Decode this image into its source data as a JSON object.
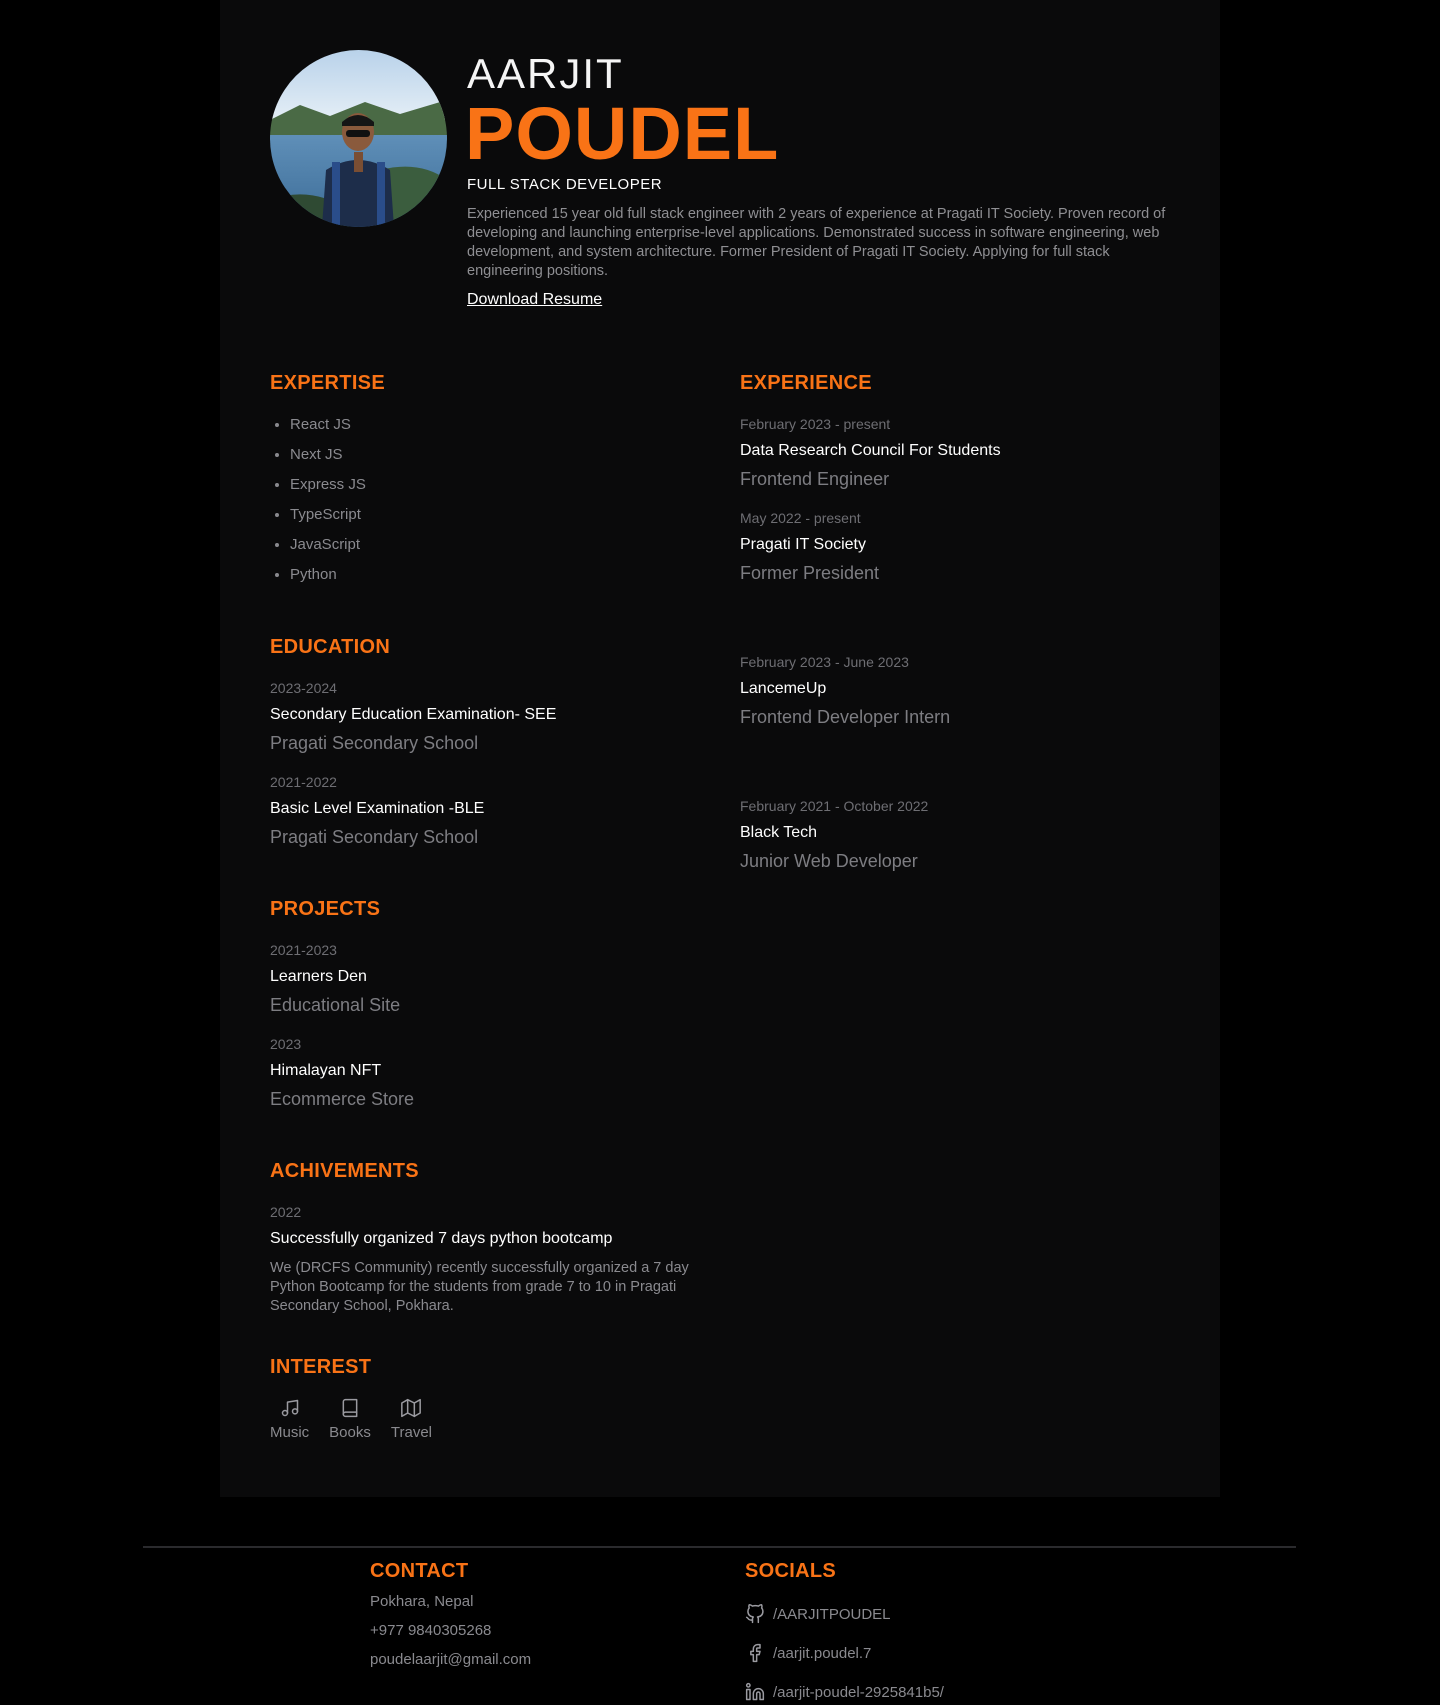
{
  "header": {
    "first_name": "AARJIT",
    "last_name": "POUDEL",
    "role": "FULL STACK DEVELOPER",
    "summary": "Experienced 15 year old full stack engineer with 2 years of experience at Pragati IT Society. Proven record of developing and launching enterprise-level applications. Demonstrated success in software engineering, web development, and system architecture. Former President of Pragati IT Society. Applying for full stack engineering positions.",
    "download_label": "Download Resume",
    "avatar": "profile-photo"
  },
  "expertise": {
    "title": "EXPERTISE",
    "items": [
      "React JS",
      "Next JS",
      "Express JS",
      "TypeScript",
      "JavaScript",
      "Python"
    ]
  },
  "experience": {
    "title": "EXPERIENCE",
    "items": [
      {
        "date": "February 2023 - present",
        "title": "Data Research Council For Students",
        "role": "Frontend Engineer"
      },
      {
        "date": "May 2022 - present",
        "title": "Pragati IT Society",
        "role": "Former President"
      },
      {
        "date": "February 2023 - June 2023",
        "title": "LancemeUp",
        "role": "Frontend Developer Intern"
      },
      {
        "date": "February 2021 - October 2022",
        "title": "Black Tech",
        "role": "Junior Web Developer"
      }
    ]
  },
  "education": {
    "title": "EDUCATION",
    "items": [
      {
        "date": "2023-2024",
        "title": "Secondary Education Examination- SEE",
        "school": "Pragati Secondary School"
      },
      {
        "date": "2021-2022",
        "title": "Basic Level Examination -BLE",
        "school": "Pragati Secondary School"
      }
    ]
  },
  "projects": {
    "title": "PROJECTS",
    "items": [
      {
        "date": "2021-2023",
        "title": "Learners Den",
        "desc": "Educational Site"
      },
      {
        "date": "2023",
        "title": "Himalayan NFT",
        "desc": "Ecommerce Store"
      }
    ]
  },
  "achievements": {
    "title": "ACHIVEMENTS",
    "items": [
      {
        "date": "2022",
        "title": "Successfully organized 7 days python bootcamp",
        "desc": "We (DRCFS Community) recently successfully organized a 7 day Python Bootcamp for the students from grade 7 to 10 in Pragati Secondary School, Pokhara."
      }
    ]
  },
  "interest": {
    "title": "INTEREST",
    "items": [
      {
        "label": "Music",
        "icon": "music-icon"
      },
      {
        "label": "Books",
        "icon": "book-icon"
      },
      {
        "label": "Travel",
        "icon": "map-icon"
      }
    ]
  },
  "contact": {
    "title": "CONTACT",
    "location": "Pokhara, Nepal",
    "phone": "+977 9840305268",
    "email": "poudelaarjit@gmail.com"
  },
  "socials": {
    "title": "SOCIALS",
    "items": [
      {
        "label": "/AARJITPOUDEL",
        "icon": "github-icon"
      },
      {
        "label": "/aarjit.poudel.7",
        "icon": "facebook-icon"
      },
      {
        "label": "/aarjit-poudel-2925841b5/",
        "icon": "linkedin-icon"
      }
    ]
  },
  "colors": {
    "accent": "#f97316",
    "background": "#000000",
    "card": "#0a0a0b"
  }
}
